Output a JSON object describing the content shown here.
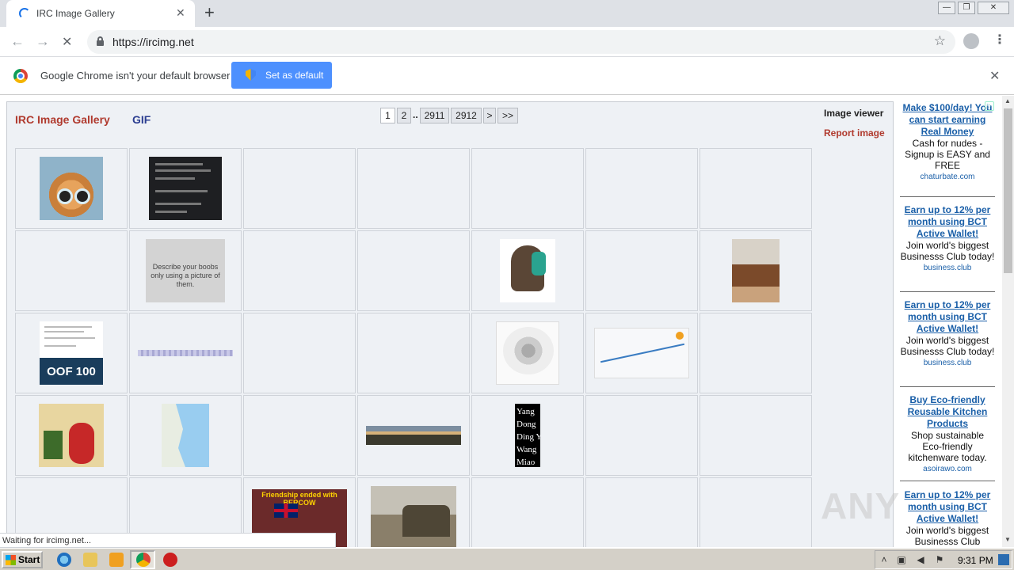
{
  "browser": {
    "tab_title": "IRC Image Gallery",
    "tab_close_glyph": "✕",
    "new_tab_glyph": "+",
    "url": "https://ircimg.net",
    "window_buttons": [
      "—",
      "❐",
      "✕"
    ],
    "back_glyph": "←",
    "forward_glyph": "→",
    "stop_glyph": "✕",
    "star_glyph": "☆",
    "menu_glyph": "⋮"
  },
  "infobar": {
    "message": "Google Chrome isn't your default browser",
    "button_label": "Set as default",
    "close_glyph": "✕"
  },
  "page": {
    "site_title": "IRC Image Gallery",
    "gif_link": "GIF",
    "pager": [
      "1",
      "2",
      "2911",
      "2912",
      ">",
      ">>"
    ],
    "pager_ellipsis": "..",
    "current_page": "1",
    "image_viewer": "Image viewer",
    "report_image": "Report image",
    "thumb_text_boobs": "Describe your boobs only using a picture of them.",
    "thumb_text_oof": "OOF 100",
    "thumb_names": [
      "Yang",
      "Dong",
      "Ding Y",
      "Wang",
      "Miao"
    ],
    "thumb_meme_caption": "Friendship ended with BERCOW"
  },
  "ads": [
    {
      "headline": "Make $100/day! You can start earning Real Money",
      "body": "Cash for nudes - Signup is EASY and FREE",
      "source": "chaturbate.com"
    },
    {
      "headline": "Earn up to 12% per month using BCT Active Wallet!",
      "body": "Join world's biggest Businesss Club today!",
      "source": "business.club"
    },
    {
      "headline": "Earn up to 12% per month using BCT Active Wallet!",
      "body": "Join world's biggest Businesss Club today!",
      "source": "business.club"
    },
    {
      "headline": "Buy Eco-friendly Reusable Kitchen Products",
      "body": "Shop sustainable Eco-friendly kitchenware today.",
      "source": "asoirawo.com"
    },
    {
      "headline": "Earn up to 12% per month using BCT Active Wallet!",
      "body": "Join world's biggest Businesss Club",
      "source": ""
    }
  ],
  "status_bar": "Waiting for ircimg.net...",
  "watermark": "ANY",
  "taskbar": {
    "start_label": "Start",
    "clock": "9:31 PM"
  },
  "colors": {
    "site_title": "#b03a2e",
    "gif_link": "#2c3e91",
    "ad_link": "#1a5fa8",
    "set_default_button": "#4d90fe"
  },
  "icons": {
    "tab_spinner": "loading-spinner-icon",
    "lock": "lock-icon",
    "star": "bookmark-star-icon",
    "profile": "profile-avatar-icon",
    "chrome": "chrome-logo-icon",
    "shield": "uac-shield-icon"
  }
}
